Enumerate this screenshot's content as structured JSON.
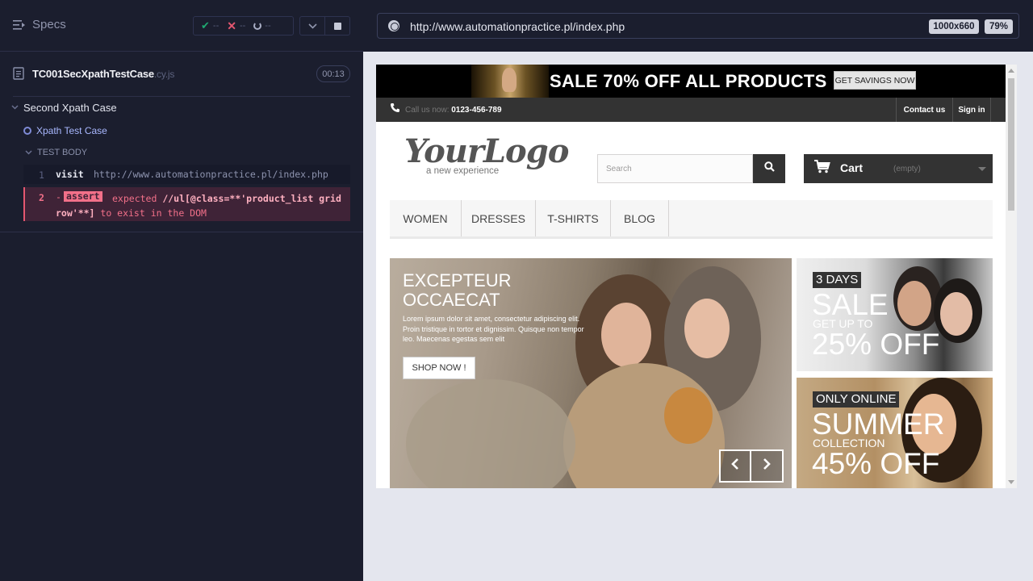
{
  "reporter": {
    "specs_label": "Specs",
    "stats": {
      "passed": "--",
      "failed": "--",
      "pending": "--"
    },
    "spec": {
      "name": "TC001SecXpathTestCase",
      "ext": ".cy.js",
      "duration": "00:13"
    },
    "suite_title": "Second Xpath Case",
    "test_title": "Xpath Test Case",
    "test_body_label": "TEST BODY",
    "commands": [
      {
        "num": "1",
        "name": "visit",
        "arg": "http://www.automationpractice.pl/index.php"
      },
      {
        "num": "2",
        "name": "assert",
        "prefix": "-",
        "message_pre": "expected ",
        "message_selector": "//ul[@class=**'product_list grid row'**]",
        "message_post": " to exist in the DOM"
      }
    ]
  },
  "aut": {
    "url": "http://www.automationpractice.pl/index.php",
    "viewport_size": "1000x660",
    "scale": "79%"
  },
  "site": {
    "promo_text": "SALE 70% OFF ALL PRODUCTS",
    "promo_button": "GET SAVINGS NOW",
    "call_label": "Call us now:",
    "phone": "0123-456-789",
    "contact_link": "Contact us",
    "signin_link": "Sign in",
    "logo_main": "YourLogo",
    "logo_sub": "a new experience",
    "search_placeholder": "Search",
    "cart_label": "Cart",
    "cart_status": "(empty)",
    "menu": [
      "Women",
      "Dresses",
      "T-shirts",
      "Blog"
    ],
    "hero": {
      "title_line1": "EXCEPTEUR",
      "title_line2": "OCCAECAT",
      "text": "Lorem ipsum dolor sit amet, consectetur adipiscing elit. Proin tristique in tortor et dignissim. Quisque non tempor leo. Maecenas egestas sem elit",
      "button": "SHOP NOW !"
    },
    "banner1": {
      "tag": "3 DAYS",
      "big1": "SALE",
      "small": "GET UP TO",
      "big2": "25% OFF"
    },
    "banner2": {
      "tag": "ONLY ONLINE",
      "big1": "SUMMER",
      "small": "COLLECTION",
      "big2": "45% OFF"
    }
  },
  "colors": {
    "reporter_bg": "#1b1e2e",
    "pass": "#1fa971",
    "fail": "#e45770",
    "running": "#7f8bd6",
    "site_dark": "#333333"
  }
}
